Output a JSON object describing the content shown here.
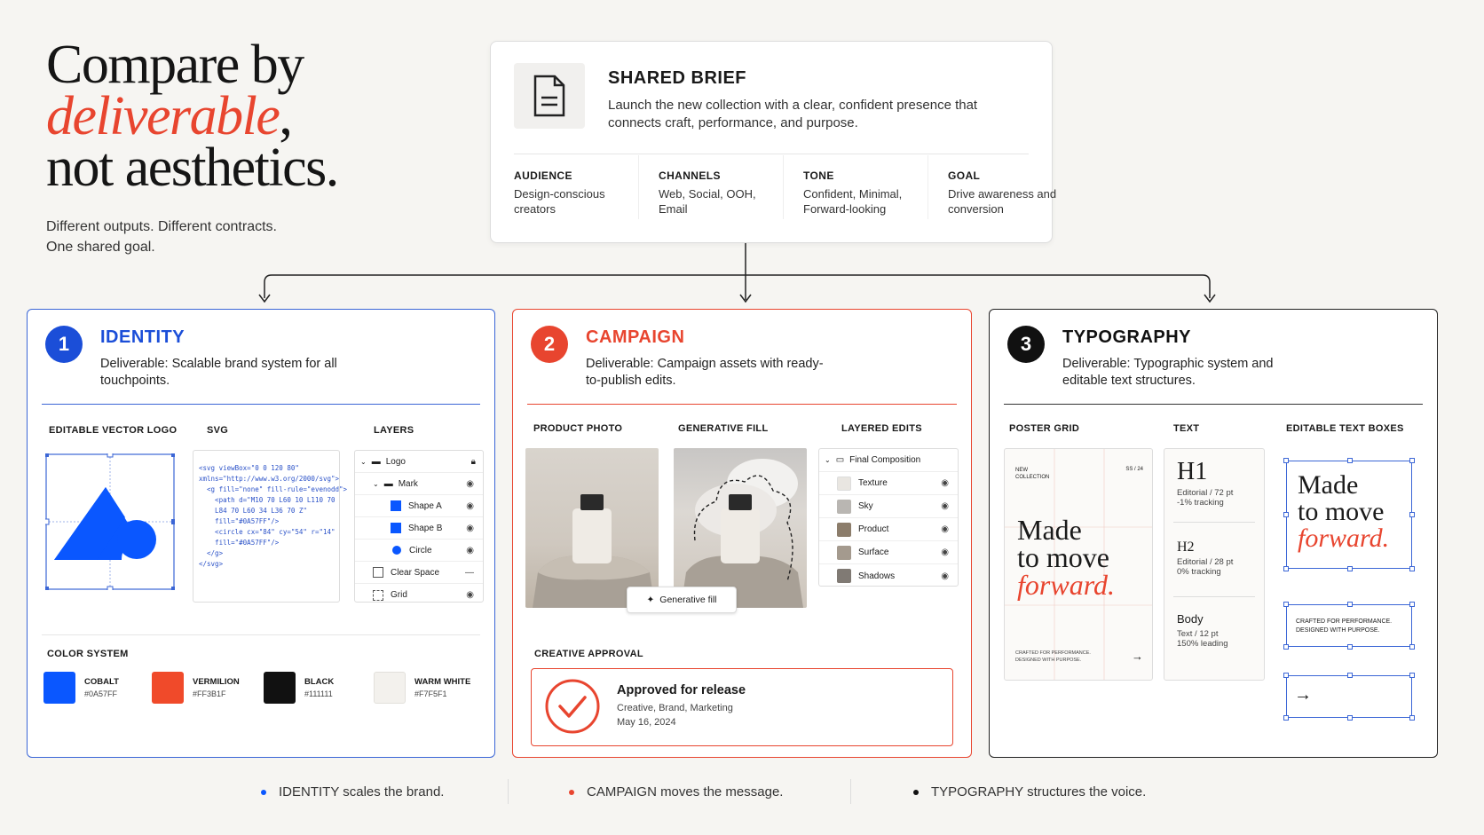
{
  "hero": {
    "line1": "Compare by",
    "line2_accent": "deliverable",
    "line2_tail": ",",
    "line3": "not aesthetics.",
    "sub1": "Different outputs. Different contracts.",
    "sub2": "One shared goal."
  },
  "brief": {
    "icon": "document-icon",
    "title": "SHARED BRIEF",
    "desc": "Launch the new collection with a clear, confident presence that connects craft, performance, and purpose.",
    "columns": [
      {
        "heading": "AUDIENCE",
        "text": "Design-conscious creators"
      },
      {
        "heading": "CHANNELS",
        "text": "Web, Social, OOH, Email"
      },
      {
        "heading": "TONE",
        "text": "Confident, Minimal, Forward-looking"
      },
      {
        "heading": "GOAL",
        "text": "Drive awareness and conversion"
      }
    ]
  },
  "colors": {
    "cobalt": "#0A57FF",
    "vermilion": "#E8452F",
    "black": "#111111"
  },
  "identity": {
    "number": "1",
    "title": "IDENTITY",
    "desc": "Deliverable: Scalable brand system for all touchpoints.",
    "logo_label": "EDITABLE VECTOR LOGO",
    "svg_label": "SVG",
    "svg_code": "<svg viewBox=\"0 0 120 80\"\nxmlns=\"http://www.w3.org/2000/svg\">\n  <g fill=\"none\" fill-rule=\"evenodd\">\n    <path d=\"M10 70 L60 10 L110 70\n    L84 70 L60 34 L36 70 Z\"\n    fill=\"#0A57FF\"/>\n    <circle cx=\"84\" cy=\"54\" r=\"14\"\n    fill=\"#0A57FF\"/>\n  </g>\n</svg>",
    "layers_label": "LAYERS",
    "layers": [
      {
        "name": "Logo",
        "icon": "folder-icon",
        "right": "lock-icon"
      },
      {
        "name": "Mark",
        "icon": "folder-icon",
        "right": "eye-icon"
      },
      {
        "name": "Shape A",
        "icon": "square-icon",
        "right": "eye-icon"
      },
      {
        "name": "Shape B",
        "icon": "square-icon",
        "right": "eye-icon"
      },
      {
        "name": "Circle",
        "icon": "circle-icon",
        "right": "eye-icon"
      },
      {
        "name": "Clear Space",
        "icon": "clearspace-icon",
        "right": "dash-icon"
      },
      {
        "name": "Grid",
        "icon": "grid-icon",
        "right": "eye-icon"
      }
    ],
    "color_label": "COLOR SYSTEM",
    "swatches": [
      {
        "name": "COBALT",
        "hex": "#0A57FF",
        "color": "#0A57FF"
      },
      {
        "name": "VERMILION",
        "hex": "#FF3B1F",
        "color": "#F04A2A"
      },
      {
        "name": "BLACK",
        "hex": "#111111",
        "color": "#111111"
      },
      {
        "name": "WARM WHITE",
        "hex": "#F7F5F1",
        "color": "#F3F1ED"
      }
    ]
  },
  "campaign": {
    "number": "2",
    "title": "CAMPAIGN",
    "desc": "Deliverable: Campaign assets with ready-to-publish edits.",
    "photo_label": "PRODUCT PHOTO",
    "fill_label": "GENERATIVE FILL",
    "gen_button": "Generative fill",
    "edits_label": "LAYERED EDITS",
    "edits": [
      {
        "name": "Final Composition",
        "thumb": "#ffffff"
      },
      {
        "name": "Texture",
        "thumb": "#e9e6e1"
      },
      {
        "name": "Sky",
        "thumb": "#b9b6b2"
      },
      {
        "name": "Product",
        "thumb": "#8c7d6b"
      },
      {
        "name": "Surface",
        "thumb": "#a49a8e"
      },
      {
        "name": "Shadows",
        "thumb": "#807a74"
      }
    ],
    "approval_label": "CREATIVE APPROVAL",
    "approval_title": "Approved for release",
    "approval_teams": "Creative, Brand, Marketing",
    "approval_date": "May 16, 2024"
  },
  "typography": {
    "number": "3",
    "title": "TYPOGRAPHY",
    "desc": "Deliverable: Typographic system and editable text structures.",
    "poster_label": "POSTER GRID",
    "poster_top_left": "NEW\nCOLLECTION",
    "poster_top_right": "SS / 24",
    "poster_l1": "Made",
    "poster_l2": "to move",
    "poster_l3": "forward.",
    "poster_foot": "CRAFTED FOR PERFORMANCE.\nDESIGNED WITH PURPOSE.",
    "text_label": "TEXT",
    "styles": [
      {
        "name": "H1",
        "spec1": "Editorial / 72 pt",
        "spec2": "-1% tracking"
      },
      {
        "name": "H2",
        "spec1": "Editorial / 28 pt",
        "spec2": "0% tracking"
      },
      {
        "name": "Body",
        "spec1": "Text / 12 pt",
        "spec2": "150% leading"
      }
    ],
    "boxes_label": "EDITABLE TEXT BOXES",
    "box_l1": "Made",
    "box_l2": "to move",
    "box_l3": "forward.",
    "box_small": "CRAFTED FOR PERFORMANCE.\nDESIGNED WITH PURPOSE."
  },
  "footer": [
    {
      "text": "IDENTITY scales the brand.",
      "color": "#0A57FF"
    },
    {
      "text": "CAMPAIGN moves the message.",
      "color": "#E8452F"
    },
    {
      "text": "TYPOGRAPHY structures the voice.",
      "color": "#111111"
    }
  ]
}
